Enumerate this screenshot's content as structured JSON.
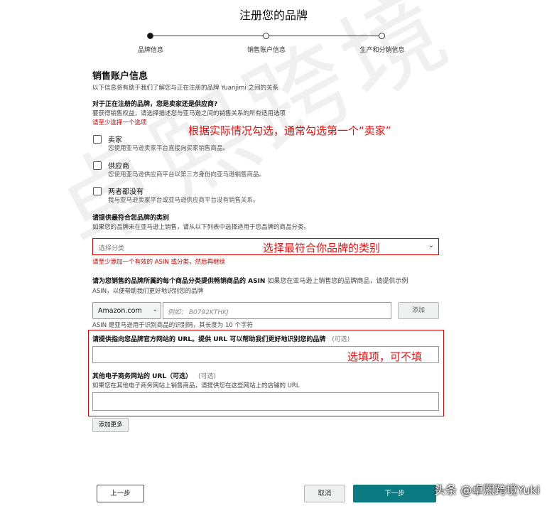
{
  "page": {
    "title": "注册您的品牌"
  },
  "stepper": {
    "steps": [
      "品牌信息",
      "销售账户信息",
      "生产和分销信息"
    ],
    "current_index": 0
  },
  "section": {
    "heading": "销售账户信息",
    "intro": "以下信息将有助于我们了解您与正在注册的品牌 Yuanjimi 之间的关系"
  },
  "seller_question": {
    "title": "对于正在注册的品牌，您是卖家还是供应商?",
    "help": "要获得销售权益，请选择描述您与亚马逊之间的销售关系的所有适用选项",
    "error": "请至少选择一个选项",
    "options": [
      {
        "label": "卖家",
        "desc": "您使用亚马逊卖家平台直接向买家销售商品。",
        "checked": false
      },
      {
        "label": "供应商",
        "desc": "您使用亚马逊供应商平台以第三方身份向亚马逊销售商品。",
        "checked": false
      },
      {
        "label": "两者都没有",
        "desc": "我与亚马逊卖家平台或亚马逊供应商平台没有销售关系。",
        "checked": false
      }
    ]
  },
  "category": {
    "title": "请提供最符合您品牌的类别",
    "help": "如果您的品牌未在亚马逊上销售，请从以下列表中选择适用于您品牌的商品分类。",
    "placeholder": "选择分类",
    "error": "请至少添加一个有效的 ASIN 或分类，然后再继续"
  },
  "asin": {
    "title": "请为您销售的品牌所属的每个商品分类提供畅销商品的 ASIN",
    "help_inline": "如果您在亚马逊上销售您的品牌商品，请提供示例",
    "help_line2": "ASIN，以便帮助我们更好地识别您的品牌",
    "marketplace": "Amazon.com",
    "placeholder": "例如： B0792KTHKJ",
    "add_button": "添加",
    "note": "ASIN 是亚马逊用于识别商品的识别码，其长度为 10 个字符"
  },
  "official_url": {
    "title": "请提供指向您品牌官方网站的 URL。提供 URL 可以帮助我们更好地识别您的品牌",
    "optional": "(可选)",
    "value": ""
  },
  "other_sites": {
    "title": "其他电子商务网站的 URL（可选）",
    "optional": "(可选)",
    "help": "如果您在其他电子商务网站上销售商品，请提供您在这些网站上的店铺的 URL",
    "value": "",
    "add_more": "添加更多"
  },
  "footer": {
    "back": "上一步",
    "cancel": "取消",
    "next": "下一步"
  },
  "annotations": {
    "tip_seller": "根据实际情况勾选，通常勾选第一个“卖家”",
    "tip_category": "选择最符合你品牌的类别",
    "tip_optional": "选填项，可不填"
  },
  "overlay": {
    "watermark": "卓熙跨境",
    "source": "头条 @卓熙跨境Yuki"
  },
  "colors": {
    "primary": "#0b7b81",
    "error": "#c40000",
    "annotation": "#e01010"
  }
}
